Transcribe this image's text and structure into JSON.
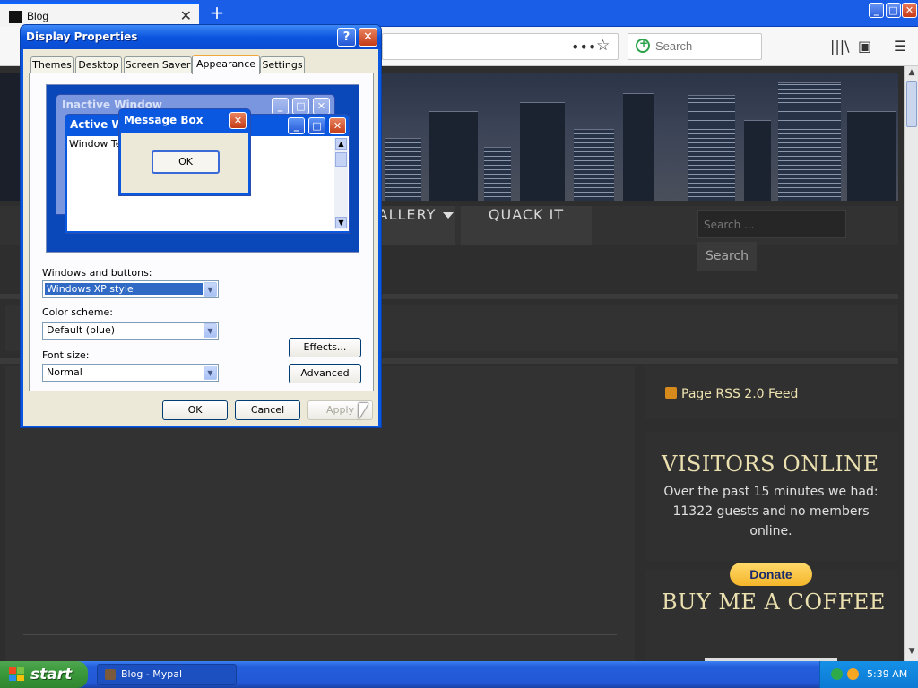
{
  "browser": {
    "tab_title": "Blog",
    "tab_close": "✕",
    "new_tab": "+",
    "search_placeholder": "Search",
    "url_dots": "•••",
    "bookmark_star": "☆",
    "library_icon": "|||\\",
    "sidebar_icon": "▣",
    "menu_icon": "☰"
  },
  "site": {
    "menu": {
      "gallery": "ALLERY",
      "quack": "QUACK IT"
    },
    "search_placeholder": "Search ...",
    "search_button": "Search",
    "rss_link": "Page RSS 2.0 Feed",
    "visitors_title": "VISITORS ONLINE",
    "visitors_text": "Over the past 15 minutes we had: 11322 guests and no members online.",
    "coffee_title": "BUY ME A COFFEE",
    "donate_button": "Donate"
  },
  "dialog": {
    "title": "Display Properties",
    "help_button": "?",
    "close_button": "✕",
    "tabs": [
      "Themes",
      "Desktop",
      "Screen Saver",
      "Appearance",
      "Settings"
    ],
    "active_tab": "Appearance",
    "preview": {
      "inactive_title": "Inactive Window",
      "active_title": "Active Window",
      "window_text": "Window Text",
      "msgbox_title": "Message Box",
      "msgbox_ok": "OK"
    },
    "windows_buttons_label": "Windows and buttons:",
    "windows_buttons_value": "Windows XP style",
    "color_scheme_label": "Color scheme:",
    "color_scheme_value": "Default (blue)",
    "font_size_label": "Font size:",
    "font_size_value": "Normal",
    "effects_button": "Effects...",
    "advanced_button": "Advanced",
    "ok_button": "OK",
    "cancel_button": "Cancel",
    "apply_button": "Apply"
  },
  "taskbar": {
    "start_label": "start",
    "task_button": "Blog - Mypal",
    "clock": "5:39 AM"
  },
  "colors": {
    "xp_blue": "#0a58e0",
    "dialog_face": "#ece9d8",
    "site_bg": "#2e2e2e",
    "site_accent": "#eadfae",
    "start_green": "#3c9a3c"
  }
}
